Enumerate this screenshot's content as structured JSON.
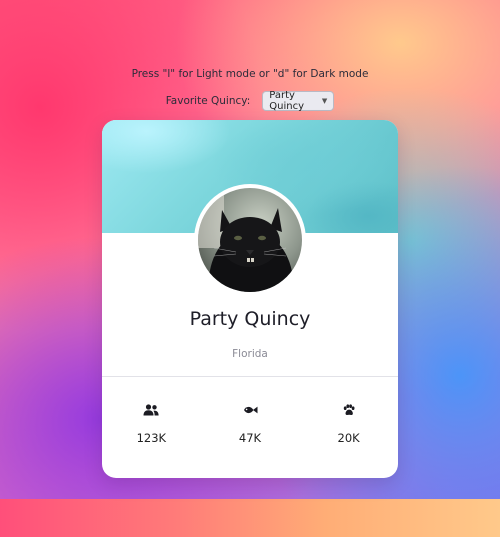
{
  "hint": "Press \"l\" for Light mode or \"d\" for Dark mode",
  "picker": {
    "label": "Favorite Quincy:",
    "selected": "Party Quincy"
  },
  "profile": {
    "name": "Party Quincy",
    "location": "Florida"
  },
  "stats": [
    {
      "icon": "users-icon",
      "value": "123K"
    },
    {
      "icon": "fish-icon",
      "value": "47K"
    },
    {
      "icon": "paw-icon",
      "value": "20K"
    }
  ],
  "colors": {
    "banner": "#7fd8de",
    "card": "#ffffff",
    "name_text": "#1e1e28",
    "muted_text": "#8a8a95"
  }
}
